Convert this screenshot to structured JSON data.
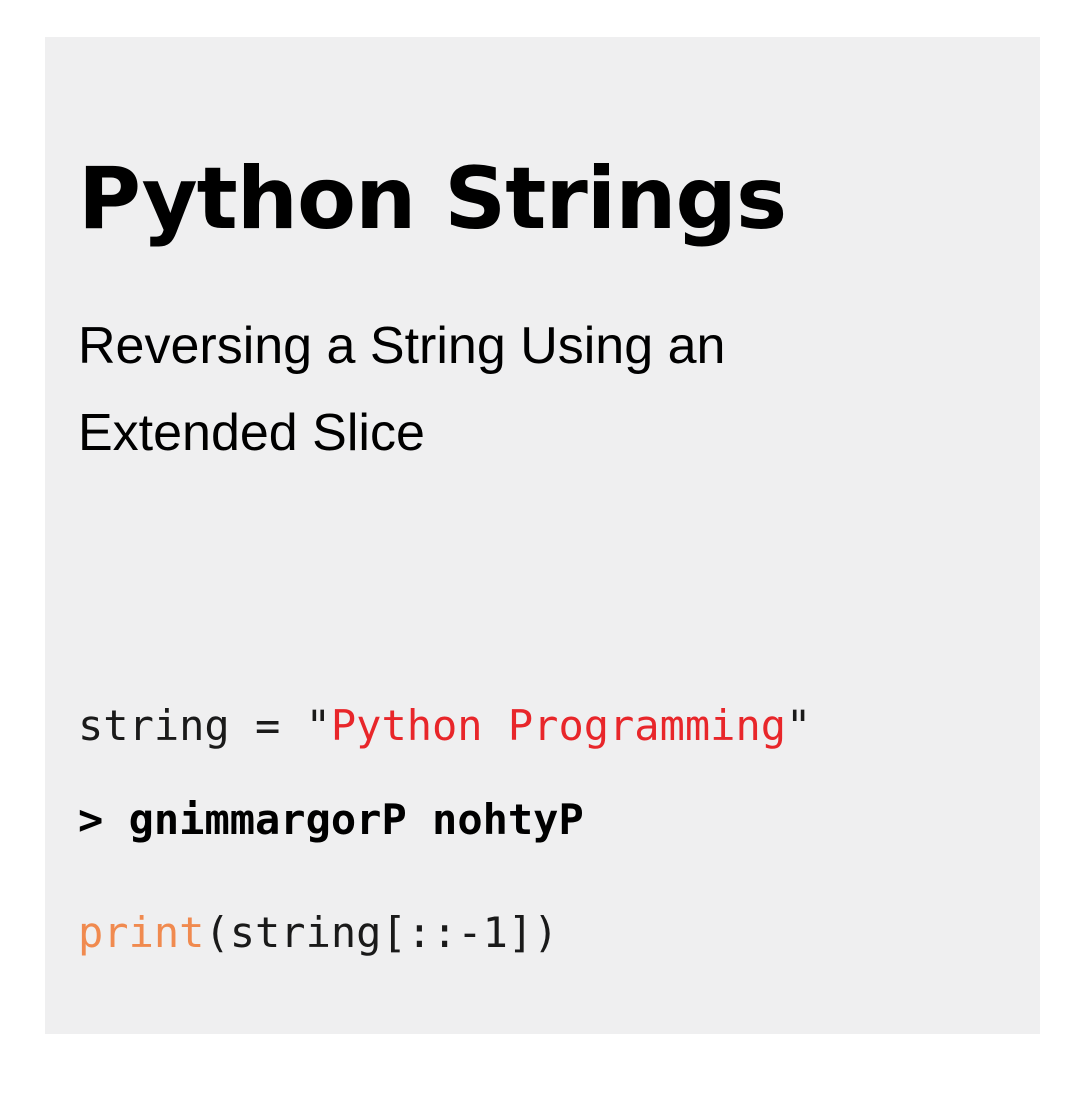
{
  "title": "Python Strings",
  "subtitle": {
    "line1": "Reversing a String Using an",
    "line2": "Extended Slice"
  },
  "code": {
    "line1": {
      "prefix": "string = \"",
      "string_literal": "Python Programming",
      "suffix": "\""
    },
    "line2": {
      "function": "print",
      "rest": "(string[::-1])"
    }
  },
  "output": {
    "prompt": ">",
    "text": "gnimmargorP nohtyP"
  },
  "colors": {
    "background": "#efeff0",
    "string_literal": "#e8262a",
    "function": "#f08a4f",
    "text": "#000000"
  }
}
